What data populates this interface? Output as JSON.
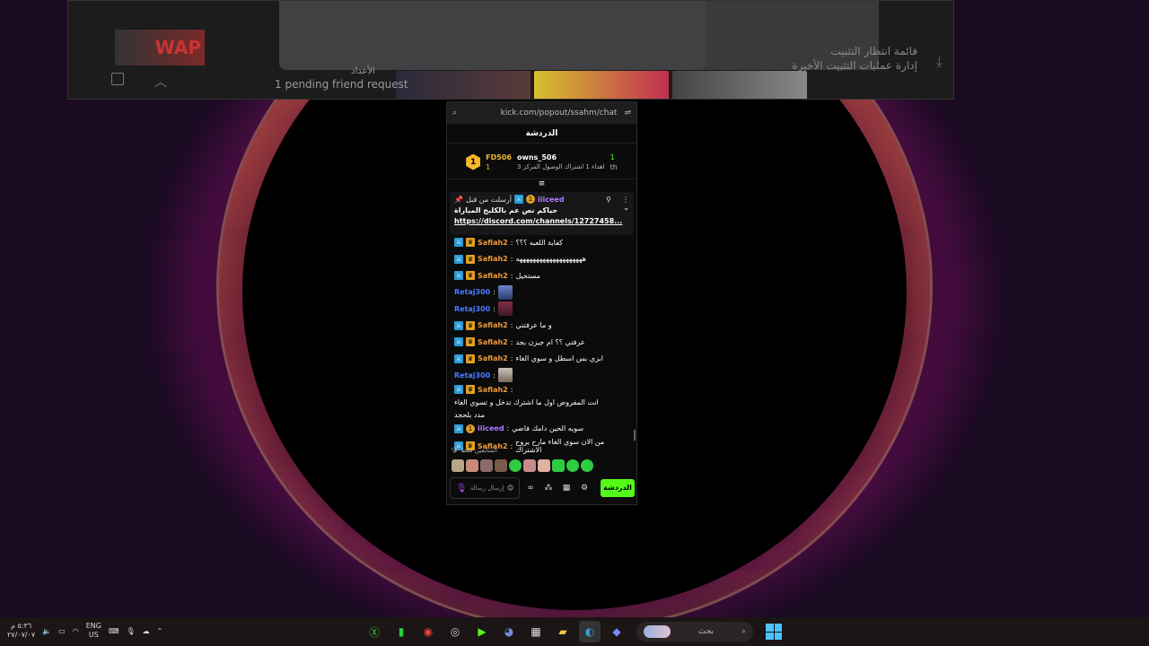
{
  "background_window": {
    "friend_request": "1 pending friend request",
    "small_text": "الأعداد",
    "thumb_label": "WAP",
    "queue_title": "قائمة انتظار التثبيت",
    "queue_subtitle": "إدارة عمليات التثبيت الأخيرة"
  },
  "chat": {
    "url": "kick.com/popout/ssahm/chat",
    "header_title": "الدردشة",
    "leaderboard": {
      "rank": "1",
      "user1": "FD506",
      "user1_sub": "1",
      "user2": "owns_506",
      "user2_sub": "اهداء 1 اشتراك الوصول المركز 3",
      "count": "1",
      "suffix": "th"
    },
    "pinned": {
      "label": "أرسلت من قبل",
      "user": "iiiceed",
      "text": "حياكم نص عم بالكلبح المباراة",
      "link": "https://discord.com/channels/12727458..."
    },
    "messages": [
      {
        "user": "Safiah2",
        "text": "كفاية اللعبه ؟؟؟",
        "kind": "orange"
      },
      {
        "user": "Safiah2",
        "text": "ههههههههههههههههههههه",
        "kind": "orange"
      },
      {
        "user": "Safiah2",
        "text": "مستحيل",
        "kind": "orange"
      },
      {
        "user": "Retaj300",
        "text": "",
        "kind": "blue"
      },
      {
        "user": "Retaj300",
        "text": "",
        "kind": "blue"
      },
      {
        "user": "Safiah2",
        "text": "و ما عرفتني",
        "kind": "orange"
      },
      {
        "user": "Safiah2",
        "text": "عرفتي ؟؟ ام جيزن بجد",
        "kind": "orange"
      },
      {
        "user": "Safiah2",
        "text": "ابزي بس اسطل و سوي الغاء",
        "kind": "orange"
      },
      {
        "user": "Retaj300",
        "text": "",
        "kind": "blue"
      },
      {
        "user": "Safiah2",
        "text": "انت المفروض اول ما اشترك تدخل و تسوي الغاء",
        "text2": "مدد بلحجد",
        "kind": "orange"
      },
      {
        "user": "iiiceed",
        "text": "سويه الحين دامك فاضي",
        "kind": "purple"
      },
      {
        "user": "Safiah2",
        "text": "من الان سوي الغاء مارح يروح الاشتراك",
        "kind": "orange"
      }
    ],
    "typing": "المتابعين فقط",
    "input_placeholder": "إرسال رسالة",
    "send_label": "الدردشة",
    "colors": {
      "send": "#53fc18",
      "orange_user": "#f29a33",
      "blue_user": "#4b7bff",
      "purple_user": "#b07cff"
    }
  },
  "taskbar": {
    "time": "٥:٣٦ م",
    "date": "٢٧/٠٧/٠٧",
    "lang1": "ENG",
    "lang2": "US",
    "search_label": "بحث"
  }
}
